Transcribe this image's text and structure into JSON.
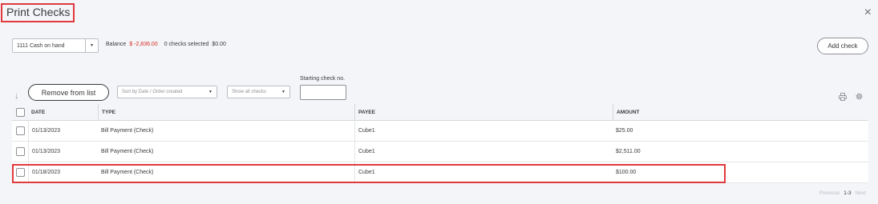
{
  "header": {
    "title": "Print Checks",
    "close_label": "×"
  },
  "account": {
    "selected": "1111 Cash on hand",
    "caret": "▼"
  },
  "balance_bar": {
    "balance_label": "Balance",
    "balance_value": "$ -2,836.00",
    "checks_selected": "0 checks selected",
    "selected_total": "$0.00"
  },
  "add_check_label": "Add check",
  "toolbar": {
    "sort_icon": "↓",
    "remove_label": "Remove from list",
    "sort_dropdown": {
      "value": "Sort by Date / Order created",
      "caret": "▼"
    },
    "show_dropdown": {
      "value": "Show all checks",
      "caret": "▼"
    },
    "starting_check_label": "Starting check no.",
    "starting_check_value": ""
  },
  "table": {
    "headers": {
      "date": "DATE",
      "type": "TYPE",
      "payee": "PAYEE",
      "amount": "AMOUNT"
    },
    "rows": [
      {
        "date": "01/13/2023",
        "type": "Bill Payment (Check)",
        "payee": "Cube1",
        "amount": "$25.00"
      },
      {
        "date": "01/13/2023",
        "type": "Bill Payment (Check)",
        "payee": "Cube1",
        "amount": "$2,511.00"
      },
      {
        "date": "01/18/2023",
        "type": "Bill Payment (Check)",
        "payee": "Cube1",
        "amount": "$100.00"
      }
    ]
  },
  "pagination": {
    "previous": "Previous",
    "range": "1-3",
    "next": "Next"
  },
  "colors": {
    "negative": "#d52b1e",
    "highlight": "#e0393e",
    "background": "#f4f5f8"
  }
}
